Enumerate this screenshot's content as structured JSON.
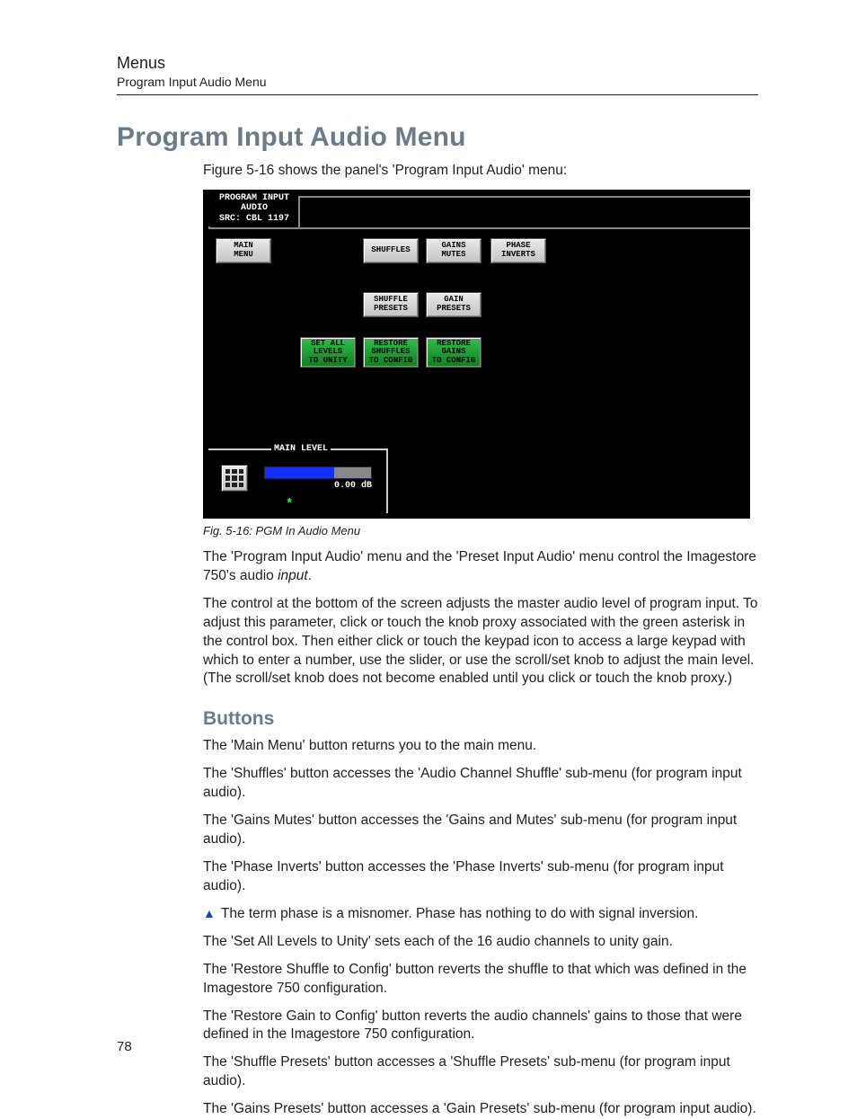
{
  "header": {
    "chapter": "Menus",
    "sub": "Program Input Audio Menu"
  },
  "title": "Program Input Audio Menu",
  "intro": "Figure 5-16 shows the panel's 'Program Input Audio' menu:",
  "panel": {
    "title_line1": "PROGRAM INPUT",
    "title_line2": "AUDIO",
    "title_line3": "SRC: CBL 1197",
    "buttons": {
      "main_menu": "MAIN\nMENU",
      "shuffles": "SHUFFLES",
      "gains_mutes": "GAINS\nMUTES",
      "phase_inverts": "PHASE\nINVERTS",
      "shuffle_presets": "SHUFFLE\nPRESETS",
      "gain_presets": "GAIN\nPRESETS",
      "set_all_unity": "SET ALL\nLEVELS\nTO UNITY",
      "restore_shuffles": "RESTORE\nSHUFFLES\nTO CONFIG",
      "restore_gains": "RESTORE\nGAINS\nTO CONFIG"
    },
    "main_level": {
      "label": "MAIN LEVEL",
      "value": "0.00 dB",
      "asterisk": "*"
    }
  },
  "caption": "Fig. 5-16: PGM In Audio Menu",
  "para1a": "The 'Program Input Audio' menu and the 'Preset Input Audio' menu control the Imagestore 750's audio ",
  "para1b": "input",
  "para1c": ".",
  "para2": "The control at the bottom of the screen adjusts the master audio level of program input. To adjust this parameter, click or touch the knob proxy associated with the green asterisk in the control box. Then either click or touch the keypad icon to access a large keypad with which to enter a number, use the slider, or use the scroll/set knob to adjust the main level. (The scroll/set knob does not become enabled until you click or touch the knob proxy.)",
  "buttons_heading": "Buttons",
  "b1": "The 'Main Menu' button returns you to the main menu.",
  "b2": "The 'Shuffles' button accesses the 'Audio Channel Shuffle' sub-menu (for program input audio).",
  "b3": "The 'Gains Mutes' button accesses the 'Gains and Mutes' sub-menu (for program input audio).",
  "b4": "The 'Phase Inverts' button accesses the 'Phase Inverts' sub-menu (for program input audio).",
  "note_triangle": "▲",
  "note": "The term phase is a misnomer. Phase has nothing to do with signal inversion.",
  "b5": "The 'Set All Levels to Unity' sets each of the 16 audio channels to unity gain.",
  "b6": "The 'Restore Shuffle to Config' button reverts the shuffle to that which was defined in the Imagestore 750 configuration.",
  "b7": "The 'Restore Gain to Config' button reverts the audio channels' gains to those that were defined in the Imagestore 750 configuration.",
  "b8": "The 'Shuffle Presets' button accesses a 'Shuffle Presets' sub-menu (for program input audio).",
  "b9": "The 'Gains Presets' button accesses a 'Gain Presets' sub-menu (for program input audio).",
  "page_number": "78"
}
